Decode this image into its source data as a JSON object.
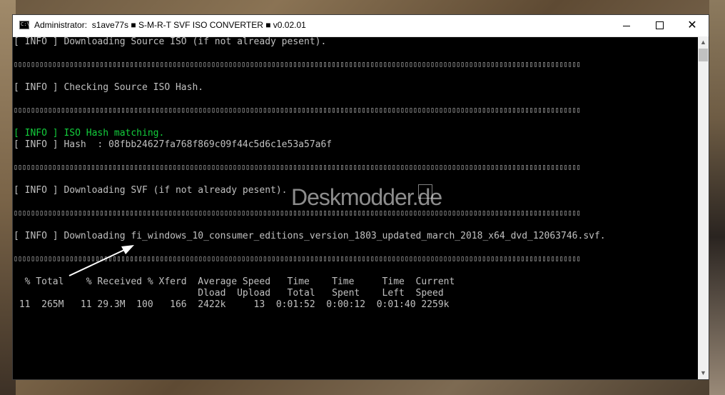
{
  "window": {
    "title": "Administrator:  s1ave77s ■ S-M-R-T SVF ISO CONVERTER ■ v0.02.01",
    "icon_label": "C:\\"
  },
  "console": {
    "lines": [
      {
        "type": "text",
        "text": "[ INFO ] Downloading Source ISO (if not already pesent)."
      },
      {
        "type": "blank",
        "text": ""
      },
      {
        "type": "sep",
        "text": "▯▯▯▯▯▯▯▯▯▯▯▯▯▯▯▯▯▯▯▯▯▯▯▯▯▯▯▯▯▯▯▯▯▯▯▯▯▯▯▯▯▯▯▯▯▯▯▯▯▯▯▯▯▯▯▯▯▯▯▯▯▯▯▯▯▯▯▯▯▯▯▯▯▯▯▯▯▯▯▯▯▯▯▯▯▯▯▯▯▯▯▯▯▯▯▯▯▯▯▯▯▯▯▯▯▯▯▯▯▯▯▯▯▯▯▯▯▯▯▯▯▯▯▯▯▯▯▯▯▯▯▯"
      },
      {
        "type": "blank",
        "text": ""
      },
      {
        "type": "text",
        "text": "[ INFO ] Checking Source ISO Hash."
      },
      {
        "type": "blank",
        "text": ""
      },
      {
        "type": "sep",
        "text": "▯▯▯▯▯▯▯▯▯▯▯▯▯▯▯▯▯▯▯▯▯▯▯▯▯▯▯▯▯▯▯▯▯▯▯▯▯▯▯▯▯▯▯▯▯▯▯▯▯▯▯▯▯▯▯▯▯▯▯▯▯▯▯▯▯▯▯▯▯▯▯▯▯▯▯▯▯▯▯▯▯▯▯▯▯▯▯▯▯▯▯▯▯▯▯▯▯▯▯▯▯▯▯▯▯▯▯▯▯▯▯▯▯▯▯▯▯▯▯▯▯▯▯▯▯▯▯▯▯▯▯▯"
      },
      {
        "type": "blank",
        "text": ""
      },
      {
        "type": "green",
        "text": "[ INFO ] ISO Hash matching."
      },
      {
        "type": "text",
        "text": "[ INFO ] Hash  : 08fbb24627fa768f869c09f44c5d6c1e53a57a6f"
      },
      {
        "type": "blank",
        "text": ""
      },
      {
        "type": "sep",
        "text": "▯▯▯▯▯▯▯▯▯▯▯▯▯▯▯▯▯▯▯▯▯▯▯▯▯▯▯▯▯▯▯▯▯▯▯▯▯▯▯▯▯▯▯▯▯▯▯▯▯▯▯▯▯▯▯▯▯▯▯▯▯▯▯▯▯▯▯▯▯▯▯▯▯▯▯▯▯▯▯▯▯▯▯▯▯▯▯▯▯▯▯▯▯▯▯▯▯▯▯▯▯▯▯▯▯▯▯▯▯▯▯▯▯▯▯▯▯▯▯▯▯▯▯▯▯▯▯▯▯▯▯▯"
      },
      {
        "type": "blank",
        "text": ""
      },
      {
        "type": "text",
        "text": "[ INFO ] Downloading SVF (if not already pesent)."
      },
      {
        "type": "blank",
        "text": ""
      },
      {
        "type": "sep",
        "text": "▯▯▯▯▯▯▯▯▯▯▯▯▯▯▯▯▯▯▯▯▯▯▯▯▯▯▯▯▯▯▯▯▯▯▯▯▯▯▯▯▯▯▯▯▯▯▯▯▯▯▯▯▯▯▯▯▯▯▯▯▯▯▯▯▯▯▯▯▯▯▯▯▯▯▯▯▯▯▯▯▯▯▯▯▯▯▯▯▯▯▯▯▯▯▯▯▯▯▯▯▯▯▯▯▯▯▯▯▯▯▯▯▯▯▯▯▯▯▯▯▯▯▯▯▯▯▯▯▯▯▯▯"
      },
      {
        "type": "blank",
        "text": ""
      },
      {
        "type": "text",
        "text": "[ INFO ] Downloading fi_windows_10_consumer_editions_version_1803_updated_march_2018_x64_dvd_12063746.svf."
      },
      {
        "type": "blank",
        "text": ""
      },
      {
        "type": "sep",
        "text": "▯▯▯▯▯▯▯▯▯▯▯▯▯▯▯▯▯▯▯▯▯▯▯▯▯▯▯▯▯▯▯▯▯▯▯▯▯▯▯▯▯▯▯▯▯▯▯▯▯▯▯▯▯▯▯▯▯▯▯▯▯▯▯▯▯▯▯▯▯▯▯▯▯▯▯▯▯▯▯▯▯▯▯▯▯▯▯▯▯▯▯▯▯▯▯▯▯▯▯▯▯▯▯▯▯▯▯▯▯▯▯▯▯▯▯▯▯▯▯▯▯▯▯▯▯▯▯▯▯▯▯▯"
      },
      {
        "type": "blank",
        "text": ""
      },
      {
        "type": "text",
        "text": "  % Total    % Received % Xferd  Average Speed   Time    Time     Time  Current"
      },
      {
        "type": "text",
        "text": "                                 Dload  Upload   Total   Spent    Left  Speed"
      },
      {
        "type": "text",
        "text": " 11  265M   11 29.3M  100   166  2422k     13  0:01:52  0:00:12  0:01:40 2259k"
      }
    ]
  },
  "watermark": {
    "text": "Deskmodder.de"
  }
}
